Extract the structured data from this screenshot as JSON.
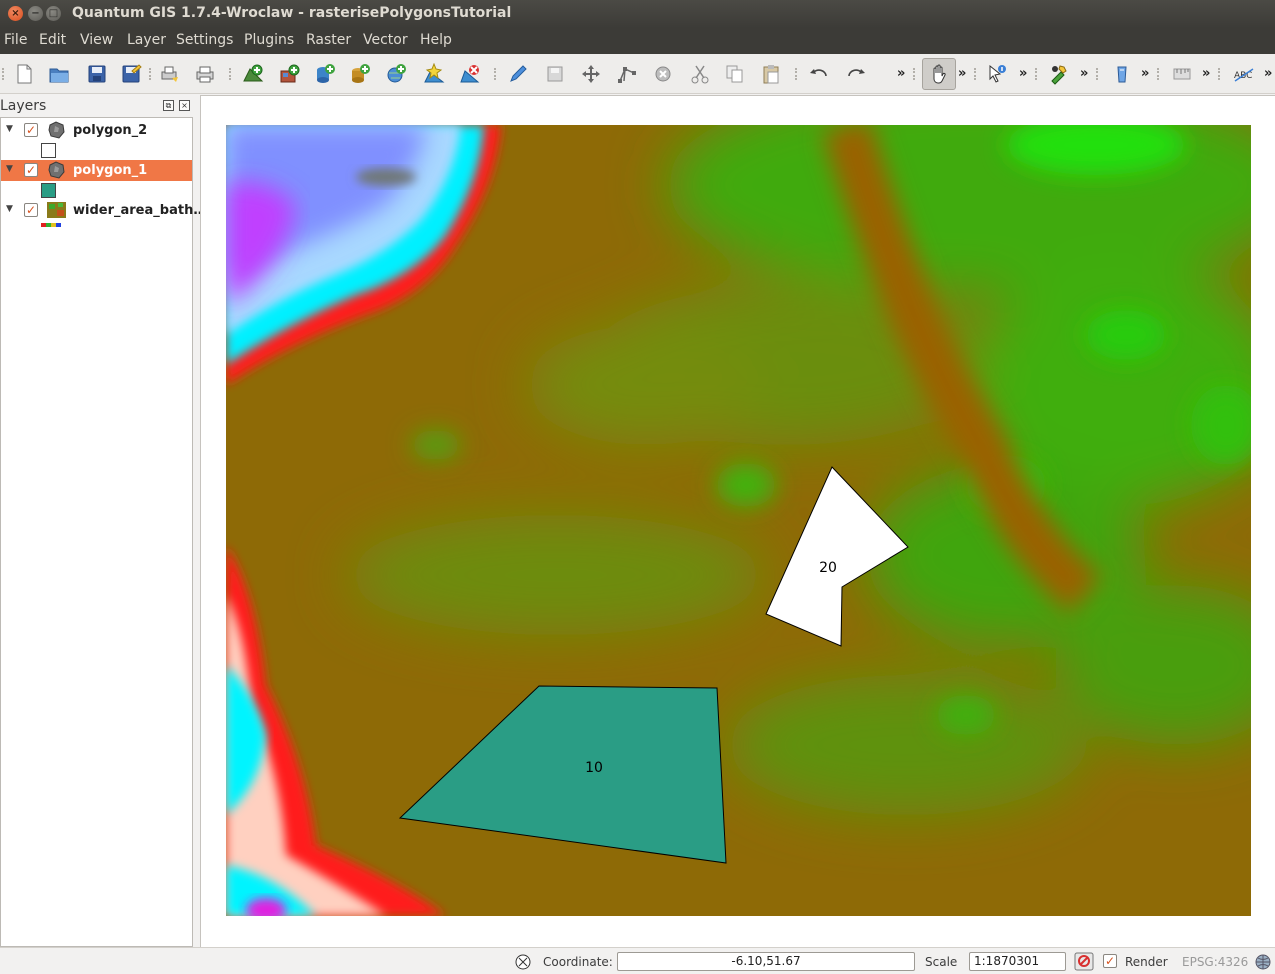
{
  "window": {
    "title": "Quantum GIS 1.7.4-Wroclaw - rasterisePolygonsTutorial",
    "close_glyph": "×",
    "minimize_glyph": "−",
    "maximize_glyph": "□"
  },
  "menu": {
    "file": "File",
    "edit": "Edit",
    "view": "View",
    "layer": "Layer",
    "settings": "Settings",
    "plugins": "Plugins",
    "raster": "Raster",
    "vector": "Vector",
    "help": "Help"
  },
  "toolbar": {
    "overflow_glyph": "»",
    "buttons": [
      "new-project",
      "open-project",
      "save-project",
      "save-as",
      "print-composer",
      "print",
      "add-vector-layer",
      "add-raster-layer",
      "add-postgis-layer",
      "add-spatialite-layer",
      "add-wms-layer",
      "new-shapefile",
      "remove-layer",
      "toggle-editing",
      "save-edits",
      "move-feature",
      "node-tool",
      "delete-selected",
      "cut-features",
      "copy-features",
      "paste-features",
      "undo",
      "redo",
      "pan-map",
      "identify",
      "plugin-tool",
      "georeferencer",
      "measure",
      "label-tool"
    ],
    "active_tool": "pan-map"
  },
  "layers_panel": {
    "title": "Layers",
    "float_glyph": "⧉",
    "close_glyph": "×",
    "layers": [
      {
        "name": "polygon_2",
        "checked": true,
        "expanded": true,
        "selected": false,
        "legend_color": "#ffffff"
      },
      {
        "name": "polygon_1",
        "checked": true,
        "expanded": true,
        "selected": true,
        "legend_color": "#2a9d85"
      },
      {
        "name": "wider_area_bath…",
        "checked": true,
        "expanded": true,
        "selected": false,
        "legend_color": "raster-ramp"
      }
    ],
    "expander_glyph": "▼",
    "check_glyph": "✓"
  },
  "map": {
    "polygons": [
      {
        "label": "20",
        "fill": "#ffffff"
      },
      {
        "label": "10",
        "fill": "#2a9d85"
      }
    ]
  },
  "status": {
    "coordinate_label": "Coordinate:",
    "coordinate_value": "-6.10,51.67",
    "scale_label": "Scale",
    "scale_value": "1:1870301",
    "render_label": "Render",
    "render_checked": true,
    "crs": "EPSG:4326"
  }
}
